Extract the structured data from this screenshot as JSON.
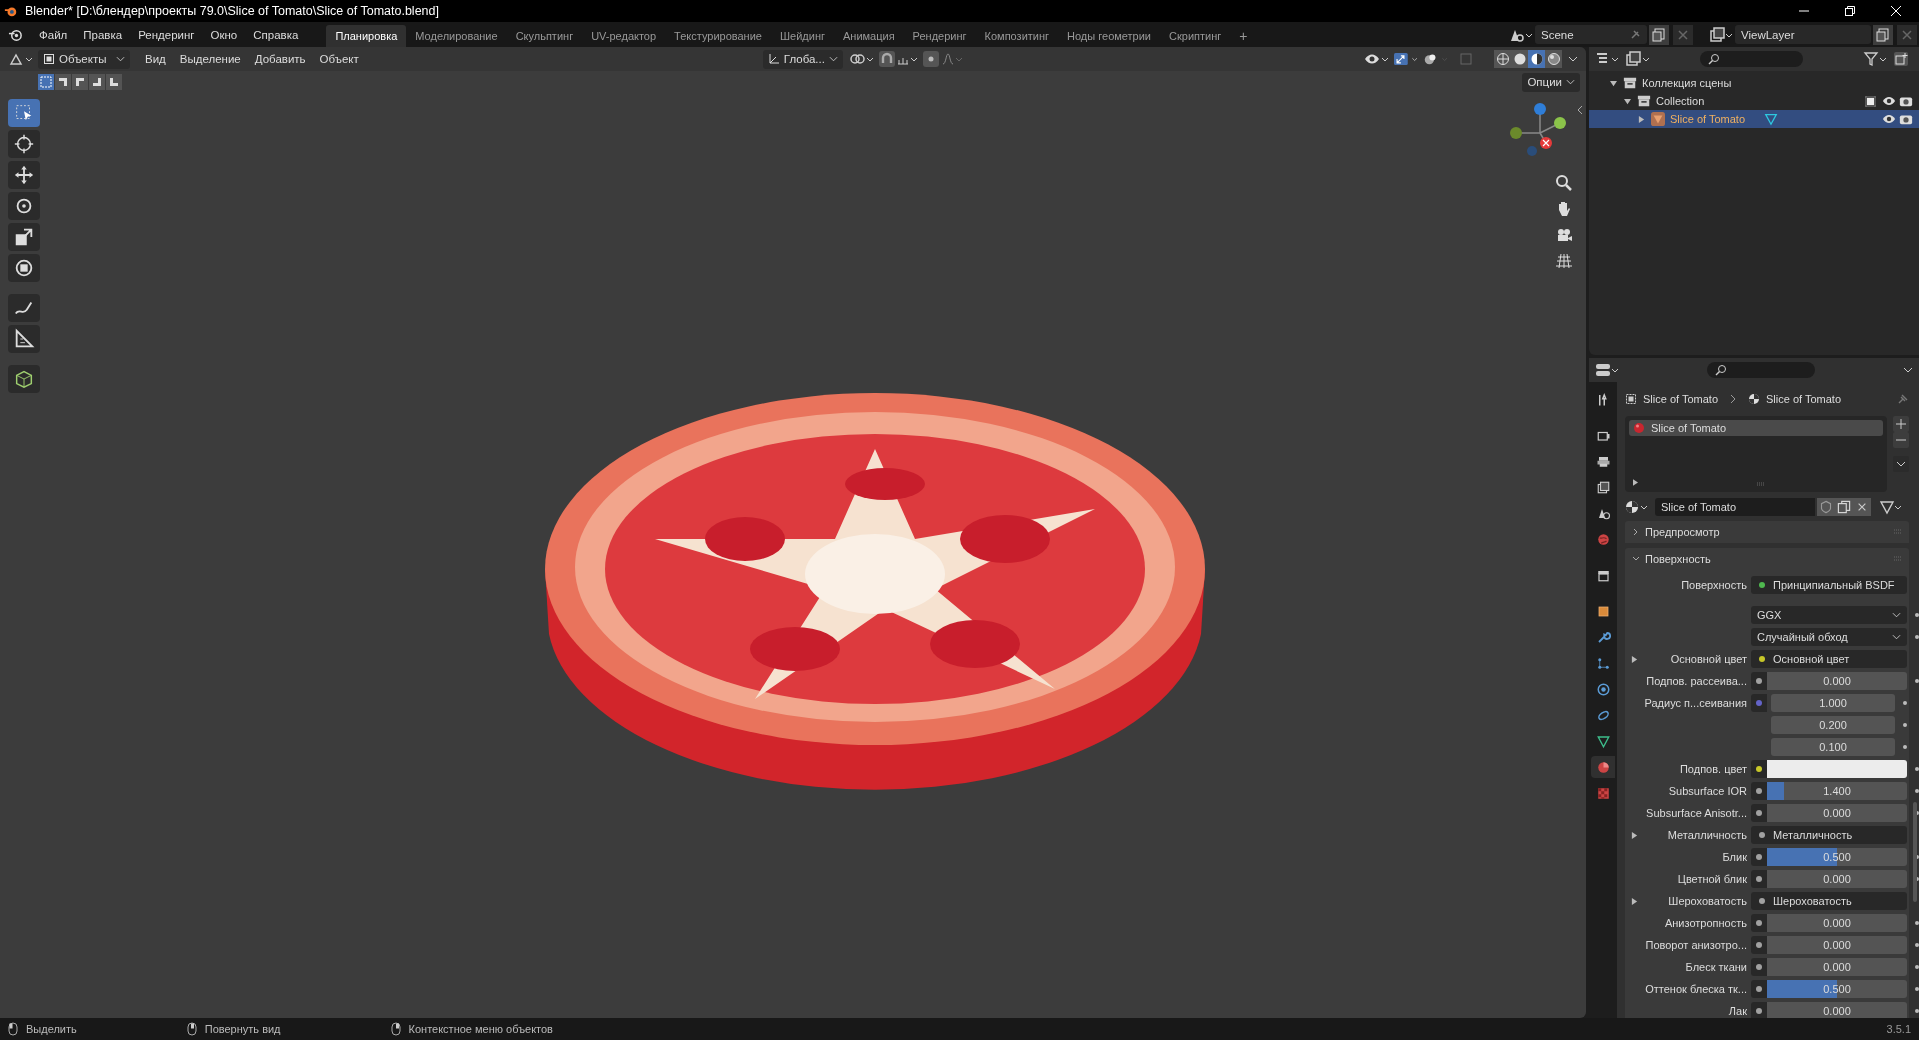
{
  "window": {
    "title": "Blender* [D:\\блендер\\проекты 79.0\\Slice of Tomato\\Slice of Tomato.blend]"
  },
  "menu": [
    "Файл",
    "Правка",
    "Рендеринг",
    "Окно",
    "Справка"
  ],
  "workspaces": [
    {
      "label": "Планировка",
      "selected": true
    },
    {
      "label": "Моделирование",
      "selected": false
    },
    {
      "label": "Скульптинг",
      "selected": false
    },
    {
      "label": "UV-редактор",
      "selected": false
    },
    {
      "label": "Текстурирование",
      "selected": false
    },
    {
      "label": "Шейдинг",
      "selected": false
    },
    {
      "label": "Анимация",
      "selected": false
    },
    {
      "label": "Рендеринг",
      "selected": false
    },
    {
      "label": "Композитинг",
      "selected": false
    },
    {
      "label": "Ноды геометрии",
      "selected": false
    },
    {
      "label": "Скриптинг",
      "selected": false
    }
  ],
  "add_workspace": "+",
  "scene": "Scene",
  "view_layer": "ViewLayer",
  "viewport": {
    "mode": "Объекты",
    "menus": [
      "Вид",
      "Выделение",
      "Добавить",
      "Объект"
    ],
    "orientation": "Глоба...",
    "options": "Опции",
    "select_modes": [
      {
        "selected": true
      },
      {
        "selected": false
      },
      {
        "selected": false
      },
      {
        "selected": false
      },
      {
        "selected": false
      }
    ],
    "shading": [
      {
        "selected": false
      },
      {
        "selected": false
      },
      {
        "selected": true
      },
      {
        "selected": false
      }
    ],
    "tools": [
      {
        "kind": "select",
        "selected": true
      },
      {
        "kind": "cursor",
        "selected": false
      },
      {
        "kind": "move",
        "selected": false
      },
      {
        "kind": "rotate",
        "selected": false
      },
      {
        "kind": "scale",
        "selected": false
      },
      {
        "kind": "transform",
        "selected": false
      },
      {
        "kind": "annotate",
        "selected": false
      },
      {
        "kind": "measure",
        "selected": false
      },
      {
        "kind": "add-cube",
        "selected": false
      }
    ]
  },
  "outliner": {
    "tree": [
      {
        "label": "Коллекция сцены",
        "selected": false,
        "children": [
          {
            "label": "Collection",
            "selected": false,
            "checked": true,
            "children": [
              {
                "label": "Slice of Tomato",
                "selected": true
              }
            ]
          }
        ]
      }
    ]
  },
  "properties": {
    "tabs": [
      {
        "kind": "tool",
        "selected": false
      },
      {
        "kind": "render",
        "selected": false
      },
      {
        "kind": "output",
        "selected": false
      },
      {
        "kind": "view-layer",
        "selected": false
      },
      {
        "kind": "scene",
        "selected": false
      },
      {
        "kind": "world",
        "selected": false
      },
      {
        "kind": "collection",
        "selected": false
      },
      {
        "kind": "object",
        "selected": false
      },
      {
        "kind": "modifier",
        "selected": false
      },
      {
        "kind": "particles",
        "selected": false
      },
      {
        "kind": "physics",
        "selected": false
      },
      {
        "kind": "constraints",
        "selected": false
      },
      {
        "kind": "data",
        "selected": false
      },
      {
        "kind": "material",
        "selected": true
      },
      {
        "kind": "texture",
        "selected": false
      }
    ],
    "breadcrumb": [
      "Slice of Tomato",
      "Slice of Tomato"
    ],
    "slots": [
      {
        "label": "Slice of Tomato",
        "selected": true
      }
    ],
    "material": "Slice of Tomato",
    "panels": [
      {
        "label": "Предпросмотр",
        "expanded": false
      },
      {
        "label": "Поверхность",
        "expanded": true
      }
    ],
    "rows": [
      {
        "kind": "link",
        "label": "Поверхность",
        "value": "Принципиальный BSDF",
        "color": "#4fb84f"
      },
      {
        "kind": "dropdown",
        "value": "GGX"
      },
      {
        "kind": "dropdown",
        "value": "Случайный обход"
      },
      {
        "kind": "link",
        "label": "Основной цвет",
        "value": "Основной цвет",
        "color": "#c7c729",
        "expanded": false
      },
      {
        "kind": "slider",
        "label": "Подпов. рассеива...",
        "value": "0.000",
        "color": "#a1a1a1"
      },
      {
        "kind": "vector",
        "label": "Радиус п...сеивания",
        "values": [
          "1.000",
          "0.200",
          "0.100"
        ],
        "color": "#6363c7"
      },
      {
        "kind": "color",
        "label": "Подпов. цвет",
        "color": "#c7c729"
      },
      {
        "kind": "slider",
        "label": "Subsurface IOR",
        "value": "1.400",
        "level": 0.12,
        "color": "#a1a1a1"
      },
      {
        "kind": "slider",
        "label": "Subsurface Anisotr...",
        "value": "0.000",
        "color": "#a1a1a1"
      },
      {
        "kind": "link",
        "label": "Металличность",
        "value": "Металличность",
        "color": "#a1a1a1",
        "expanded": false
      },
      {
        "kind": "slider",
        "label": "Блик",
        "value": "0.500",
        "level": 0.5,
        "color": "#a1a1a1"
      },
      {
        "kind": "slider",
        "label": "Цветной блик",
        "value": "0.000",
        "color": "#a1a1a1"
      },
      {
        "kind": "link",
        "label": "Шероховатость",
        "value": "Шероховатость",
        "color": "#a1a1a1",
        "expanded": false
      },
      {
        "kind": "slider",
        "label": "Анизотропность",
        "value": "0.000",
        "color": "#a1a1a1"
      },
      {
        "kind": "slider",
        "label": "Поворот анизотро...",
        "value": "0.000",
        "color": "#a1a1a1"
      },
      {
        "kind": "slider",
        "label": "Блеск ткани",
        "value": "0.000",
        "color": "#a1a1a1"
      },
      {
        "kind": "slider",
        "label": "Оттенок блеска тк...",
        "value": "0.500",
        "level": 0.5,
        "color": "#a1a1a1"
      },
      {
        "kind": "slider",
        "label": "Лак",
        "value": "0.000",
        "color": "#a1a1a1"
      }
    ]
  },
  "status_bar": {
    "hints": [
      "Выделить",
      "Повернуть вид",
      "Контекстное меню объектов"
    ],
    "version": "3.5.1"
  }
}
